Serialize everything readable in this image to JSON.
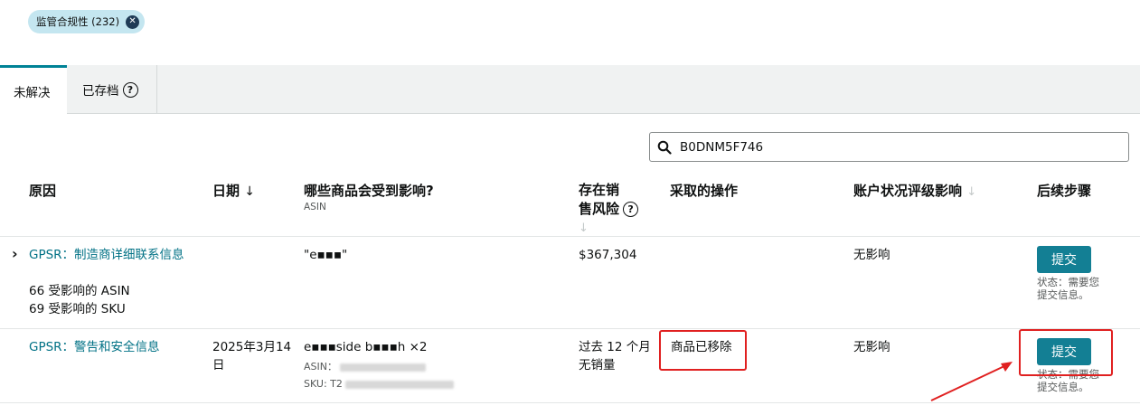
{
  "filter_chip": {
    "label": "监管合规性 (232)"
  },
  "tabs": [
    {
      "label": "未解决",
      "active": true
    },
    {
      "label": "已存档",
      "help_icon": "help-circle-icon"
    }
  ],
  "search": {
    "value": "B0DNM5F746",
    "icon": "search-icon"
  },
  "table": {
    "columns": {
      "reason": "原因",
      "date": "日期",
      "affected": "哪些商品会受到影响?",
      "affected_sub": "ASIN",
      "risk_line1": "存在销",
      "risk_line2": "售风险",
      "actions": "采取的操作",
      "account": "账户状况评级影响",
      "next": "后续步骤"
    },
    "rows": [
      {
        "reason": "GPSR：制造商详细联系信息",
        "affected_asin_count": "66 受影响的 ASIN",
        "affected_sku_count": "69 受影响的 SKU",
        "date": "",
        "product": "\"e▪▪▪\"",
        "risk": "$367,304",
        "action": "",
        "account_impact": "无影响",
        "button": "提交",
        "status_line1": "状态：需要您",
        "status_line2": "提交信息。"
      },
      {
        "reason": "GPSR：警告和安全信息",
        "date_line1": "2025年3月14",
        "date_line2": "日",
        "product": "e▪▪▪side b▪▪▪h ×2",
        "asin_label": "ASIN：",
        "sku_label": "SKU: T2",
        "risk_line1": "过去 12 个月",
        "risk_line2": "无销量",
        "action": "商品已移除",
        "account_impact": "无影响",
        "button": "提交",
        "status_line1": "状态：需要您",
        "status_line2": "提交信息。"
      }
    ]
  },
  "annotation_colors": {
    "highlight": "#e02020",
    "primary_button": "#137f94",
    "link": "#007185"
  }
}
